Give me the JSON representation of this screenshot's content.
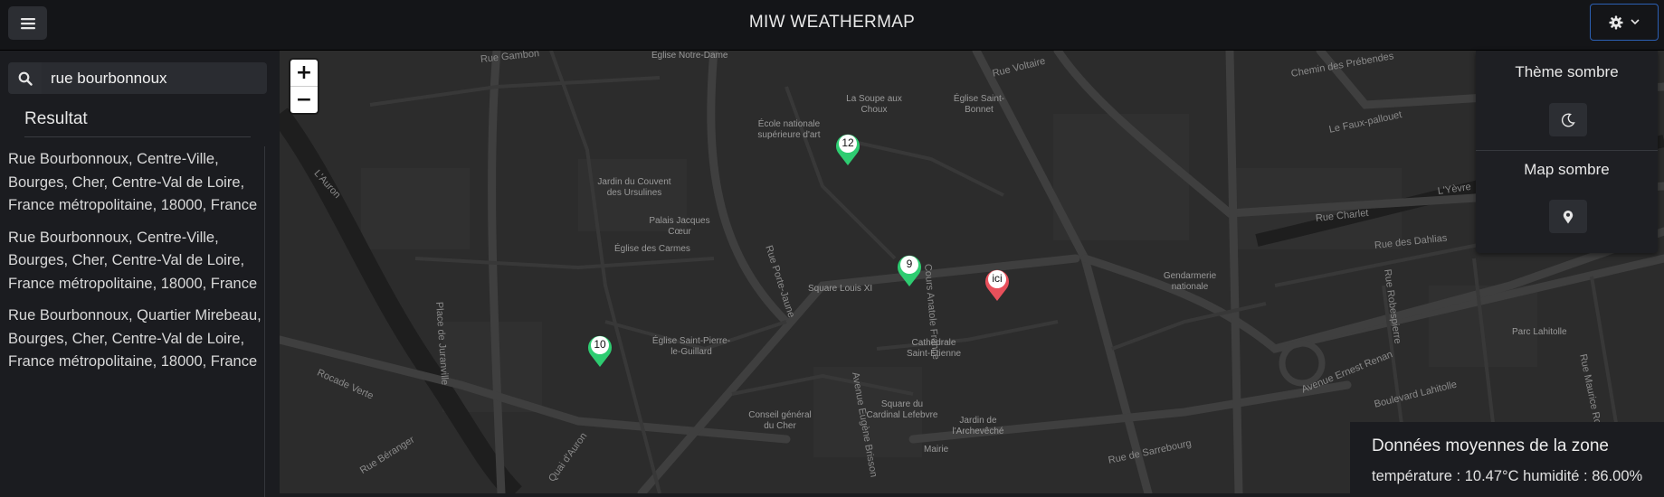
{
  "header": {
    "title": "MIW WEATHERMAP",
    "menu_icon": "hamburger-icon",
    "settings_icon": "gear-icon",
    "settings_caret_icon": "chevron-down-icon"
  },
  "search": {
    "value": "rue bourbonnoux",
    "icon": "search-icon"
  },
  "results": {
    "heading": "Resultat",
    "items": [
      "Rue Bourbonnoux, Centre-Ville, Bourges, Cher, Centre-Val de Loire, France métropolitaine, 18000, France",
      "Rue Bourbonnoux, Centre-Ville, Bourges, Cher, Centre-Val de Loire, France métropolitaine, 18000, France",
      "Rue Bourbonnoux, Quartier Mirebeau, Bourges, Cher, Centre-Val de Loire, France métropolitaine, 18000, France"
    ]
  },
  "settings": {
    "theme_label": "Thème sombre",
    "theme_icon": "moon-icon",
    "map_label": "Map sombre",
    "map_icon": "map-pin-icon"
  },
  "map": {
    "zoom_in": "+",
    "zoom_out": "−",
    "markers": [
      {
        "label": "12",
        "color": "#2ecc71"
      },
      {
        "label": "9",
        "color": "#2ecc71"
      },
      {
        "label": "10",
        "color": "#2ecc71"
      },
      {
        "label": "ici",
        "color": "#e8505b"
      }
    ],
    "places": [
      "Eglise Notre-Dame",
      "La Soupe aux Choux",
      "Église Saint-Bonnet",
      "École nationale supérieure d'art",
      "Jardin du Couvent des Ursulines",
      "Palais Jacques Cœur",
      "Église des Carmes",
      "Square Louis XI",
      "Église Saint-Pierre-le-Guillard",
      "Cathédrale Saint-Étienne",
      "Conseil général du Cher",
      "Square du Cardinal Lefebvre",
      "Jardin de l'Archevêché",
      "Mairie",
      "Gendarmerie nationale",
      "Parc Lahitolle"
    ],
    "roads": [
      "Rue Gambon",
      "Rue Voltaire",
      "Chemin des Prébendes",
      "Le Faux-pallouet",
      "L'Yèvre",
      "L'Auron",
      "Rue Porte-Jaune",
      "Cours Anatole France",
      "Rue Charlet",
      "Rue des Dahlias",
      "Rue Robespierre",
      "Avenue Ernest Renan",
      "Boulevard Lahitolle",
      "Rue Maurice Roy",
      "Place de Juranville",
      "Rocade Verte",
      "Rue Béranger",
      "Quai d'Auron",
      "Avenue Eugène Brisson",
      "Rue de Sarrebourg"
    ]
  },
  "stats": {
    "title": "Données moyennes de la zone",
    "line": "température : 10.47°C humidité : 86.00%"
  }
}
